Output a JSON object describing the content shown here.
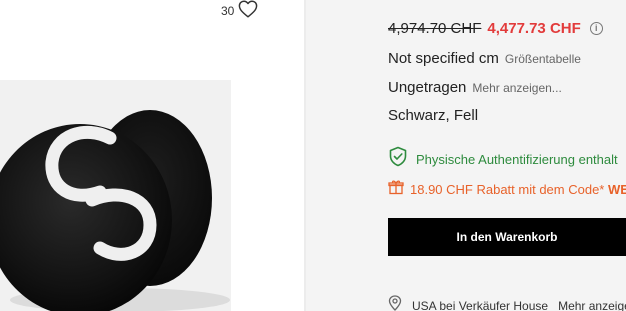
{
  "product": {
    "likes_count": "30",
    "image_alt": "Black fur earmuff with white CC logo"
  },
  "pricing": {
    "original_price": "4,974.70 CHF",
    "sale_price": "4,477.73 CHF",
    "sale_color": "#e23b3b"
  },
  "details": {
    "size": "Not specified cm",
    "size_link": "Größentabelle",
    "condition": "Ungetragen",
    "condition_link": "Mehr anzeigen...",
    "material": "Schwarz, Fell"
  },
  "authentication": {
    "text": "Physische Authentifizierung enthalt",
    "icon": "shield-check-icon",
    "color": "#2e8b3e"
  },
  "discount": {
    "text": "18.90 CHF Rabatt mit dem Code*",
    "code": "WE",
    "icon": "gift-icon",
    "color": "#e8622a"
  },
  "cart": {
    "button_label": "In den Warenkorb"
  },
  "shipping": {
    "location": "USA bei Verkäufer House",
    "more_link": "Mehr anzeige",
    "icon": "location-pin-icon"
  }
}
